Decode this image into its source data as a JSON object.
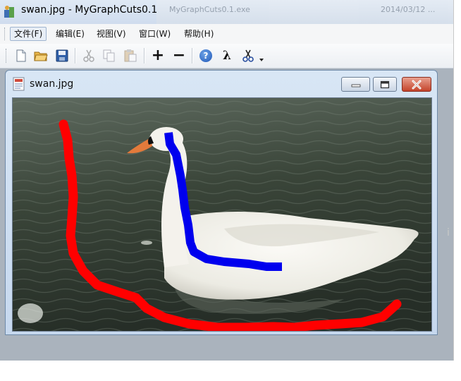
{
  "window": {
    "title": "swan.jpg - MyGraphCuts0.1",
    "background_title": "MyGraphCuts0.1.exe",
    "background_timestamp": "2014/03/12 ..."
  },
  "menu": {
    "items": [
      {
        "label": "文件(F)",
        "active": true
      },
      {
        "label": "编辑(E)"
      },
      {
        "label": "视图(V)"
      },
      {
        "label": "窗口(W)"
      },
      {
        "label": "帮助(H)"
      }
    ]
  },
  "toolbar": {
    "buttons": [
      "new-file-icon",
      "open-folder-icon",
      "save-icon",
      "cut-icon",
      "copy-icon",
      "paste-icon",
      "zoom-in-icon",
      "zoom-out-icon",
      "help-icon",
      "lambda-icon",
      "scissors-icon",
      "dropdown-arrow-icon"
    ],
    "zoom_in_glyph": "+",
    "zoom_out_glyph": "−",
    "lambda_glyph": "λ",
    "help_glyph": "?"
  },
  "document": {
    "title": "swan.jpg"
  },
  "colors": {
    "foreground_stroke": "#0000ee",
    "background_stroke": "#ff0000",
    "water_dark": "#2f3a31",
    "swan_white": "#f4f2ec"
  },
  "edge_glyph": "i"
}
